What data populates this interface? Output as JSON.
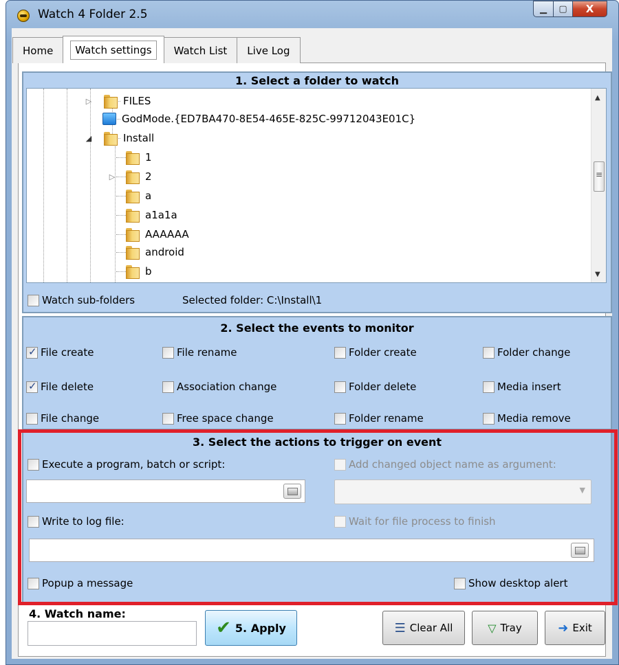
{
  "window": {
    "title": "Watch 4 Folder 2.5",
    "min_glyph": "▁",
    "max_glyph": "▢",
    "close_glyph": "X"
  },
  "tabs": [
    {
      "label": "Home"
    },
    {
      "label": "Watch settings",
      "active": true
    },
    {
      "label": "Watch List"
    },
    {
      "label": "Live Log"
    }
  ],
  "section1": {
    "title": "1. Select a folder to watch",
    "tree": [
      {
        "label": "FILES",
        "icon": "folder-icon",
        "expander": "▷"
      },
      {
        "label": "GodMode.{ED7BA470-8E54-465E-825C-99712043E01C}",
        "icon": "control-panel-icon",
        "expander": ""
      },
      {
        "label": "Install",
        "icon": "folder-icon",
        "expander": "◢"
      },
      {
        "label": "1",
        "icon": "folder-icon",
        "expander": ""
      },
      {
        "label": "2",
        "icon": "folder-icon",
        "expander": "▷"
      },
      {
        "label": "a",
        "icon": "folder-icon",
        "expander": ""
      },
      {
        "label": "a1a1a",
        "icon": "folder-icon",
        "expander": ""
      },
      {
        "label": "AAAAAA",
        "icon": "folder-icon",
        "expander": ""
      },
      {
        "label": "android",
        "icon": "folder-icon",
        "expander": ""
      },
      {
        "label": "b",
        "icon": "folder-icon",
        "expander": ""
      }
    ],
    "watch_subfolders_label": "Watch sub-folders",
    "watch_subfolders_checked": false,
    "selected_folder_text": "Selected folder: C:\\Install\\1"
  },
  "section2": {
    "title": "2. Select the events to monitor",
    "events": [
      {
        "label": "File create",
        "checked": true
      },
      {
        "label": "File rename",
        "checked": false
      },
      {
        "label": "Folder create",
        "checked": false
      },
      {
        "label": "Folder change",
        "checked": false
      },
      {
        "label": "File delete",
        "checked": true
      },
      {
        "label": "Association change",
        "checked": false
      },
      {
        "label": "Folder delete",
        "checked": false
      },
      {
        "label": "Media insert",
        "checked": false
      },
      {
        "label": "File change",
        "checked": false
      },
      {
        "label": "Free space change",
        "checked": false
      },
      {
        "label": "Folder rename",
        "checked": false
      },
      {
        "label": "Media remove",
        "checked": false
      }
    ]
  },
  "section3": {
    "title": "3. Select the actions to trigger on event",
    "execute_label": "Execute a program, batch or script:",
    "execute_path_value": "",
    "add_arg_label": "Add changed object name as argument:",
    "arg_select_value": "",
    "log_label": "Write to log file:",
    "wait_label": "Wait for file process to finish",
    "log_path_value": "",
    "popup_label": "Popup a message",
    "desktop_alert_label": "Show desktop alert"
  },
  "bottom": {
    "watch_name_label": "4. Watch name:",
    "watch_name_value": "",
    "apply_label": "5. Apply",
    "clear_all_label": "Clear All",
    "tray_label": "Tray",
    "exit_label": "Exit"
  },
  "colors": {
    "section_bg": "#b7d1f0",
    "highlight_border": "#e0202a"
  }
}
